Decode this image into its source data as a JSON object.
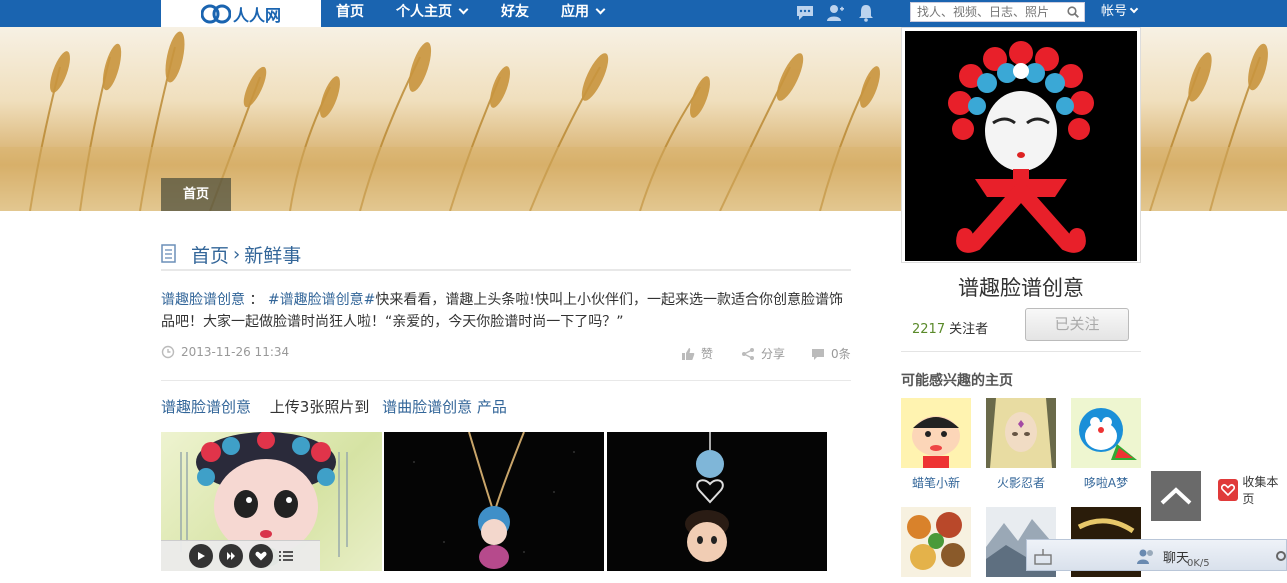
{
  "nav": {
    "logo_text": "人人网",
    "items": [
      {
        "label": "首页"
      },
      {
        "label": "个人主页"
      },
      {
        "label": "好友"
      },
      {
        "label": "应用"
      }
    ],
    "search_placeholder": "找人、视频、日志、照片",
    "account_label": "帐号"
  },
  "banner": {
    "tab_label": "首页"
  },
  "feed": {
    "breadcrumb": [
      "首页",
      "新鲜事"
    ],
    "breadcrumb_sep": "›",
    "post": {
      "author": "谱趣脸谱创意",
      "separator": " ：",
      "hashtag": "#谱趣脸谱创意#",
      "text": "快来看看，谱趣上头条啦!快叫上小伙伴们，一起来选一款适合你创意脸谱饰品吧！大家一起做脸谱时尚狂人啦！“亲爱的，今天你脸谱时尚一下了吗？”",
      "date": "2013-11-26 11:34",
      "like_label": "赞",
      "share_label": "分享",
      "comment_label": "0条"
    },
    "upload": {
      "author": "谱趣脸谱创意",
      "action": "上传3张照片到",
      "album": "谱曲脸谱创意 产品"
    }
  },
  "profile": {
    "name": "谱趣脸谱创意",
    "follower_count": "2217",
    "follower_label": "关注者",
    "follow_button": "已关注"
  },
  "recommend": {
    "title": "可能感兴趣的主页",
    "items": [
      {
        "label": "蜡笔小新"
      },
      {
        "label": "火影忍者"
      },
      {
        "label": "哆啦A梦"
      },
      {
        "label": ""
      },
      {
        "label": ""
      },
      {
        "label": ""
      }
    ]
  },
  "floating": {
    "collect_label": "收集本页",
    "chat_label": "聊天",
    "chat_status": "0K/5"
  },
  "colors": {
    "nav_bg": "#1a64b0",
    "link": "#336699",
    "follower_count": "#5a8a2a"
  }
}
